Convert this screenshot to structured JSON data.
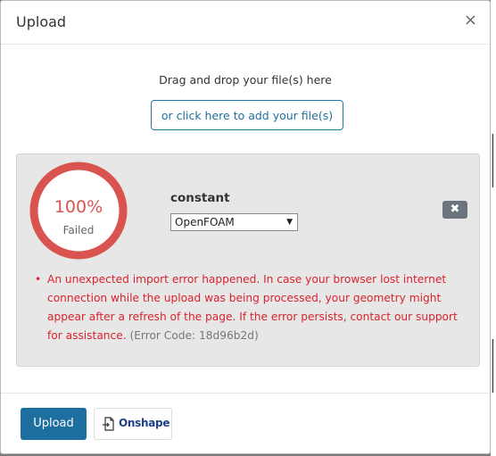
{
  "dialog": {
    "title": "Upload",
    "close_icon": "×"
  },
  "dropzone": {
    "text": "Drag and drop your file(s) here",
    "add_button_label": "or click here to add your file(s)"
  },
  "file": {
    "progress_label": "100%",
    "progress_value": 1.0,
    "status": "Failed",
    "name": "constant",
    "format_selected": "OpenFOAM",
    "remove_icon": "✖",
    "error_message": "An unexpected import error happened. In case your browser lost internet connection while the upload was being processed, your geometry might appear after a refresh of the page. If the error persists, contact our support for assistance.",
    "error_code": "(Error Code: 18d96b2d)"
  },
  "footer": {
    "upload_label": "Upload",
    "onshape_label": "Onshape"
  },
  "colors": {
    "error": "#d9232e",
    "ring": "#d9534f",
    "primary": "#1c6f9e"
  }
}
